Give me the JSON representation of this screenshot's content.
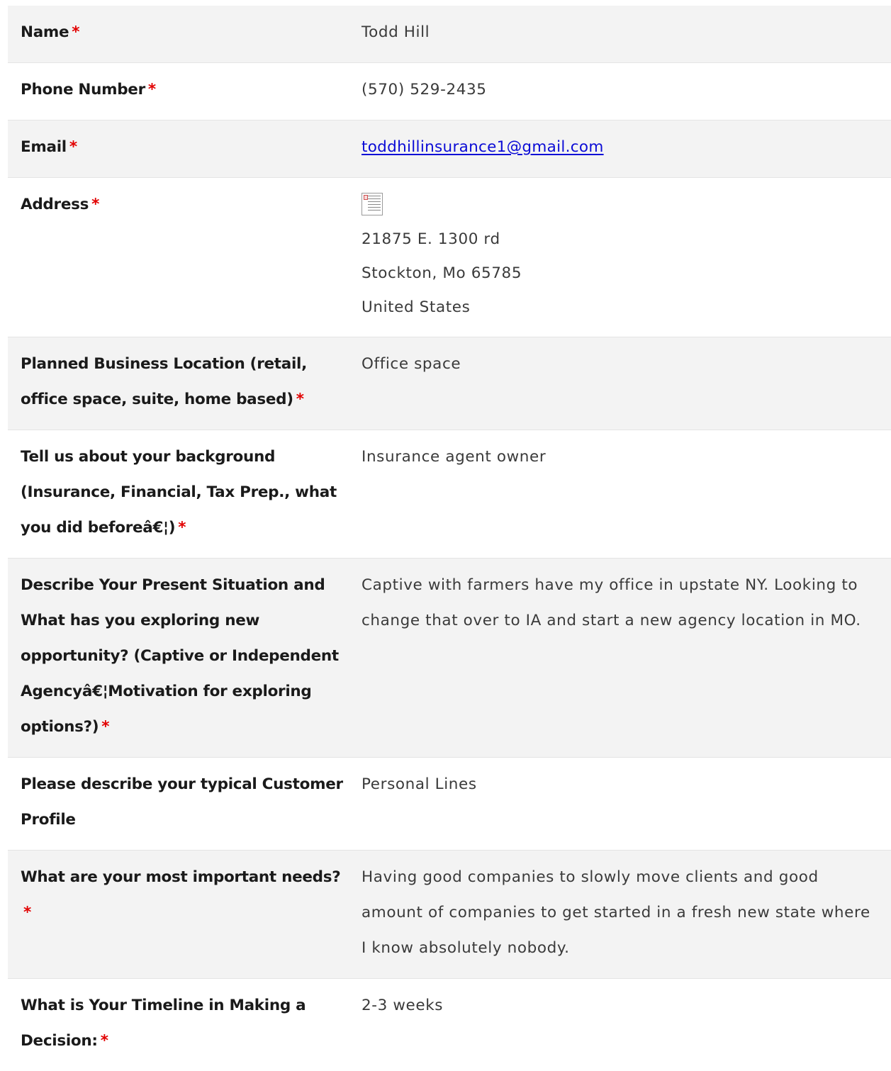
{
  "required_marker": "*",
  "fields": {
    "name": {
      "label": "Name",
      "value": "Todd Hill"
    },
    "phone": {
      "label": "Phone Number",
      "value": "(570) 529-2435"
    },
    "email": {
      "label": "Email",
      "value": "toddhillinsurance1@gmail.com"
    },
    "address": {
      "label": "Address",
      "line1": "21875 E. 1300 rd",
      "line2": "Stockton, Mo 65785",
      "line3": "United States"
    },
    "business_location": {
      "label": "Planned Business Location (retail, office space, suite, home based)",
      "value": "Office space"
    },
    "background": {
      "label": "Tell us about your background (Insurance, Financial, Tax Prep., what you did beforeâ€¦)",
      "value": "Insurance agent owner"
    },
    "present_situation": {
      "label": "Describe Your Present Situation and What has you exploring new opportunity? (Captive or Independent Agencyâ€¦Motivation for exploring options?)",
      "value": "Captive with farmers have my office in upstate NY. Looking to change that over to IA and start a new agency location in MO."
    },
    "customer_profile": {
      "label": "Please describe your typical Customer Profile",
      "value": "Personal Lines"
    },
    "important_needs": {
      "label": "What are your most important needs?",
      "value": "Having good companies to slowly move clients and good amount of companies to get started in a fresh new state where I know absolutely nobody."
    },
    "timeline": {
      "label": "What is Your Timeline in Making a Decision:",
      "value": "2-3 weeks"
    }
  },
  "colors": {
    "required": "#e20000",
    "link": "#0b0bd6",
    "row_alt_bg": "#f3f3f3",
    "label_text": "#1a1a1a",
    "value_text": "#3a3a3a"
  },
  "icons": {
    "address_image": "broken-image-icon"
  }
}
